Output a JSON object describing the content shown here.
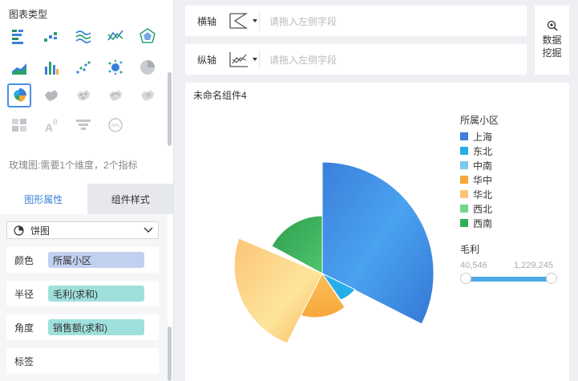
{
  "left": {
    "section_title": "图表类型",
    "hint": "玫瑰图:需要1个维度，2个指标",
    "tabs": [
      "图形属性",
      "组件样式"
    ],
    "shape_select": "饼图",
    "properties": [
      {
        "name": "颜色",
        "field": "所属小区",
        "pill": "blue"
      },
      {
        "name": "半径",
        "field": "毛利(求和)",
        "pill": "teal"
      },
      {
        "name": "角度",
        "field": "销售额(求和)",
        "pill": "teal"
      },
      {
        "name": "标签",
        "field": "",
        "pill": ""
      }
    ]
  },
  "axes": {
    "x_label": "横轴",
    "y_label": "纵轴",
    "placeholder": "请拖入左侧字段"
  },
  "mining_button": [
    "数据",
    "挖掘"
  ],
  "chart": {
    "title": "未命名组件4",
    "legend_title": "所属小区",
    "legend": [
      {
        "name": "上海",
        "color": "#3b7fdc"
      },
      {
        "name": "东北",
        "color": "#27aee8"
      },
      {
        "name": "中南",
        "color": "#7dc7f0"
      },
      {
        "name": "华中",
        "color": "#f6a83a"
      },
      {
        "name": "华北",
        "color": "#fcc479"
      },
      {
        "name": "西北",
        "color": "#6fd68c"
      },
      {
        "name": "西南",
        "color": "#34ad57"
      }
    ],
    "size_title": "毛利",
    "range_min": "40,546",
    "range_max": "1,229,245"
  },
  "chart_data": {
    "type": "pie",
    "variant": "rose",
    "categories": [
      "上海",
      "东北",
      "中南",
      "华中",
      "华北",
      "西北",
      "西南"
    ],
    "angle_field": "销售额(求和)",
    "radius_field": "毛利(求和)",
    "radius_range": [
      40546,
      1229245
    ]
  }
}
